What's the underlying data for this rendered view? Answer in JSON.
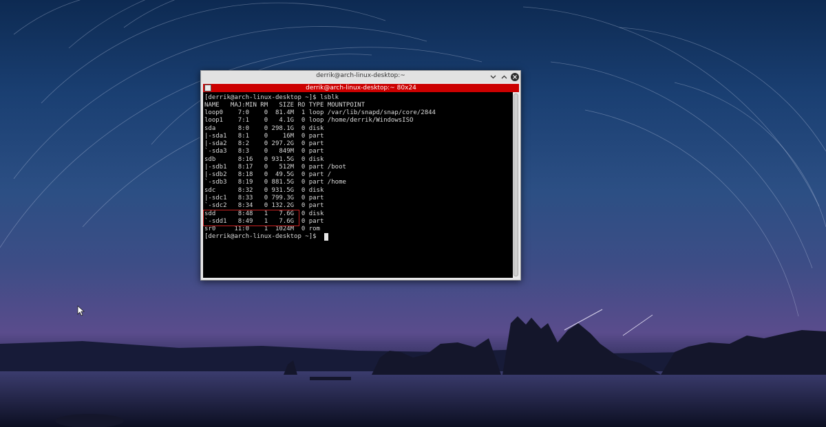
{
  "window": {
    "title": "derrik@arch-linux-desktop:~",
    "tab_title": "derrik@arch-linux-desktop:~ 80x24"
  },
  "terminal": {
    "lines": [
      "[derrik@arch-linux-desktop ~]$ lsblk",
      "NAME   MAJ:MIN RM   SIZE RO TYPE MOUNTPOINT",
      "loop0    7:0    0  81.4M  1 loop /var/lib/snapd/snap/core/2844",
      "loop1    7:1    0   4.1G  0 loop /home/derrik/WindowsISO",
      "sda      8:0    0 298.1G  0 disk",
      "|-sda1   8:1    0    16M  0 part",
      "|-sda2   8:2    0 297.2G  0 part",
      "`-sda3   8:3    0   849M  0 part",
      "sdb      8:16   0 931.5G  0 disk",
      "|-sdb1   8:17   0   512M  0 part /boot",
      "|-sdb2   8:18   0  49.5G  0 part /",
      "`-sdb3   8:19   0 881.5G  0 part /home",
      "sdc      8:32   0 931.5G  0 disk",
      "|-sdc1   8:33   0 799.3G  0 part",
      "`-sdc2   8:34   0 132.2G  0 part",
      "sdd      8:48   1   7.6G  0 disk",
      "`-sdd1   8:49   1   7.6G  0 part",
      "sr0     11:0    1  1024M  0 rom",
      "[derrik@arch-linux-desktop ~]$ "
    ]
  },
  "colors": {
    "tab_bar": "#cc0000",
    "terminal_bg": "#000000",
    "terminal_fg": "#dcdcdc",
    "highlight": "#cc2222"
  },
  "icons": {
    "minimize": "chevron-down-icon",
    "maximize": "chevron-up-icon",
    "close": "close-icon",
    "terminal": "terminal-icon",
    "pointer": "mouse-pointer-icon"
  }
}
